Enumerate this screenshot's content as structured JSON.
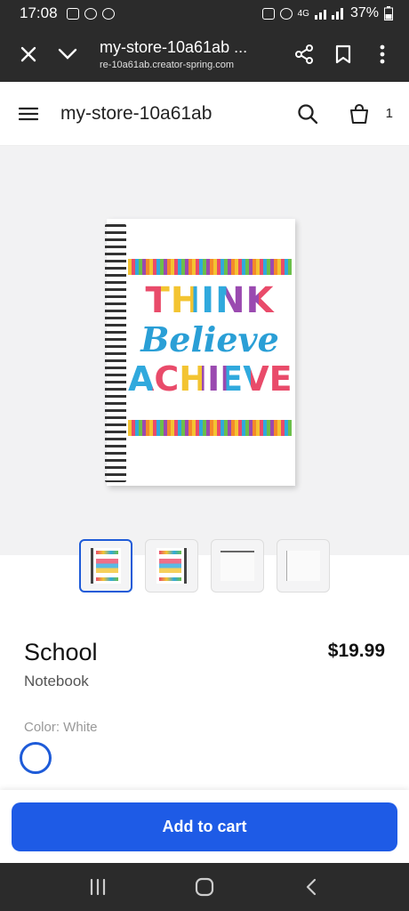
{
  "status": {
    "time": "17:08",
    "battery": "37%",
    "network": "4G"
  },
  "browser": {
    "title": "my-store-10a61ab ...",
    "url": "re-10a61ab.creator-spring.com"
  },
  "store": {
    "name": "my-store-10a61ab",
    "cart_count": "1"
  },
  "product_art": {
    "line1": "THINK",
    "line2": "Believe",
    "line3": "ACHIEVE"
  },
  "product": {
    "title": "School",
    "price": "$19.99",
    "subtitle": "Notebook",
    "color_label": "Color: White",
    "selected_color": "#ffffff",
    "add_to_cart": "Add to cart"
  },
  "colors": {
    "accent": "#1e5be6",
    "chrome": "#2b2b2b"
  }
}
